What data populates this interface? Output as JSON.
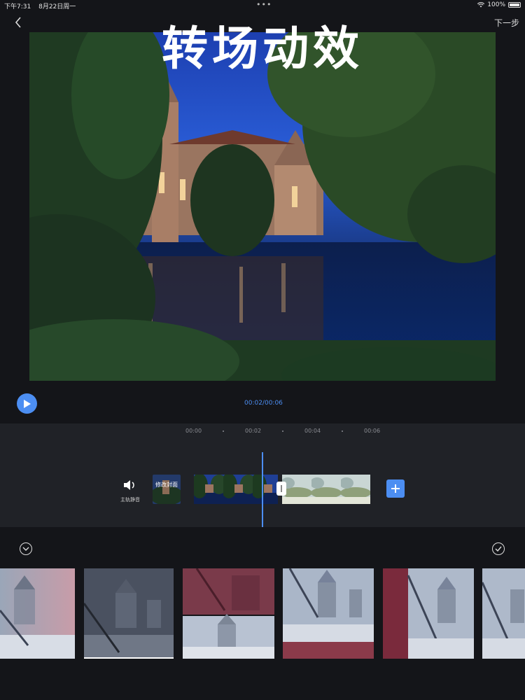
{
  "status_bar": {
    "time": "下午7:31",
    "date": "8月22日周一",
    "battery": "100%"
  },
  "nav": {
    "next_label": "下一步"
  },
  "preview": {
    "overlay_title": "转场动效"
  },
  "playback": {
    "time": "00:02/00:06"
  },
  "timeline": {
    "ruler": [
      "00:00",
      "00:02",
      "00:04",
      "00:06"
    ],
    "mute_label": "主轨静音",
    "cover_label": "修改封面"
  },
  "colors": {
    "accent": "#4c8ef2",
    "background": "#141519",
    "timeline_bg": "#202227"
  },
  "icons": [
    "chevron-left-icon",
    "wifi-icon",
    "battery-icon",
    "play-icon",
    "speaker-icon",
    "plus-icon",
    "chevron-down-icon",
    "check-icon"
  ]
}
